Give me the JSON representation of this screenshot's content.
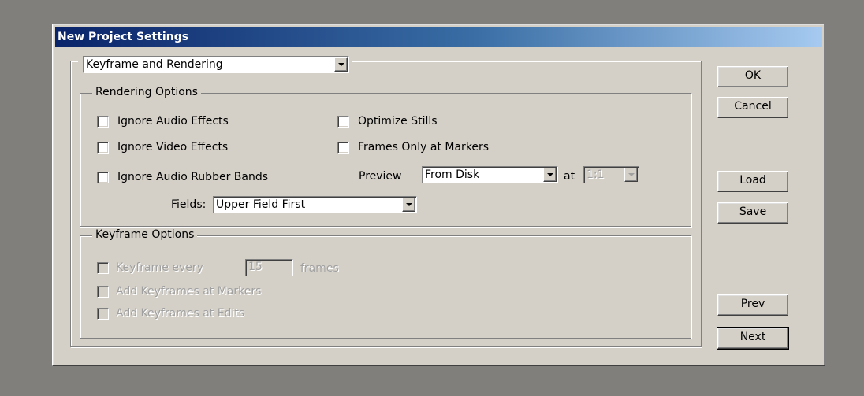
{
  "window": {
    "title": "New Project Settings"
  },
  "panel_selector": {
    "value": "Keyframe and Rendering"
  },
  "rendering_options": {
    "legend": "Rendering Options",
    "ignore_audio_effects": "Ignore Audio Effects",
    "ignore_video_effects": "Ignore Video Effects",
    "ignore_audio_rubber_bands": "Ignore Audio Rubber Bands",
    "optimize_stills": "Optimize Stills",
    "frames_only_at_markers": "Frames Only at Markers",
    "preview_label": "Preview",
    "preview_value": "From Disk",
    "at_label": "at",
    "ratio_value": "1:1",
    "fields_label": "Fields:",
    "fields_value": "Upper Field First",
    "checked": {
      "ignore_audio_effects": false,
      "ignore_video_effects": false,
      "ignore_audio_rubber_bands": false,
      "optimize_stills": false,
      "frames_only_at_markers": false
    }
  },
  "keyframe_options": {
    "legend": "Keyframe Options",
    "keyframe_every": "Keyframe every",
    "keyframe_every_value": "15",
    "frames_label": "frames",
    "add_at_markers": "Add Keyframes at Markers",
    "add_at_edits": "Add Keyframes at Edits"
  },
  "buttons": {
    "ok": "OK",
    "cancel": "Cancel",
    "load": "Load",
    "save": "Save",
    "prev": "Prev",
    "next": "Next"
  },
  "colors": {
    "desktop": "#807f7c",
    "dialog_face": "#d4d0c8",
    "title_gradient_start": "#0a246a",
    "title_gradient_end": "#a6caf0"
  }
}
